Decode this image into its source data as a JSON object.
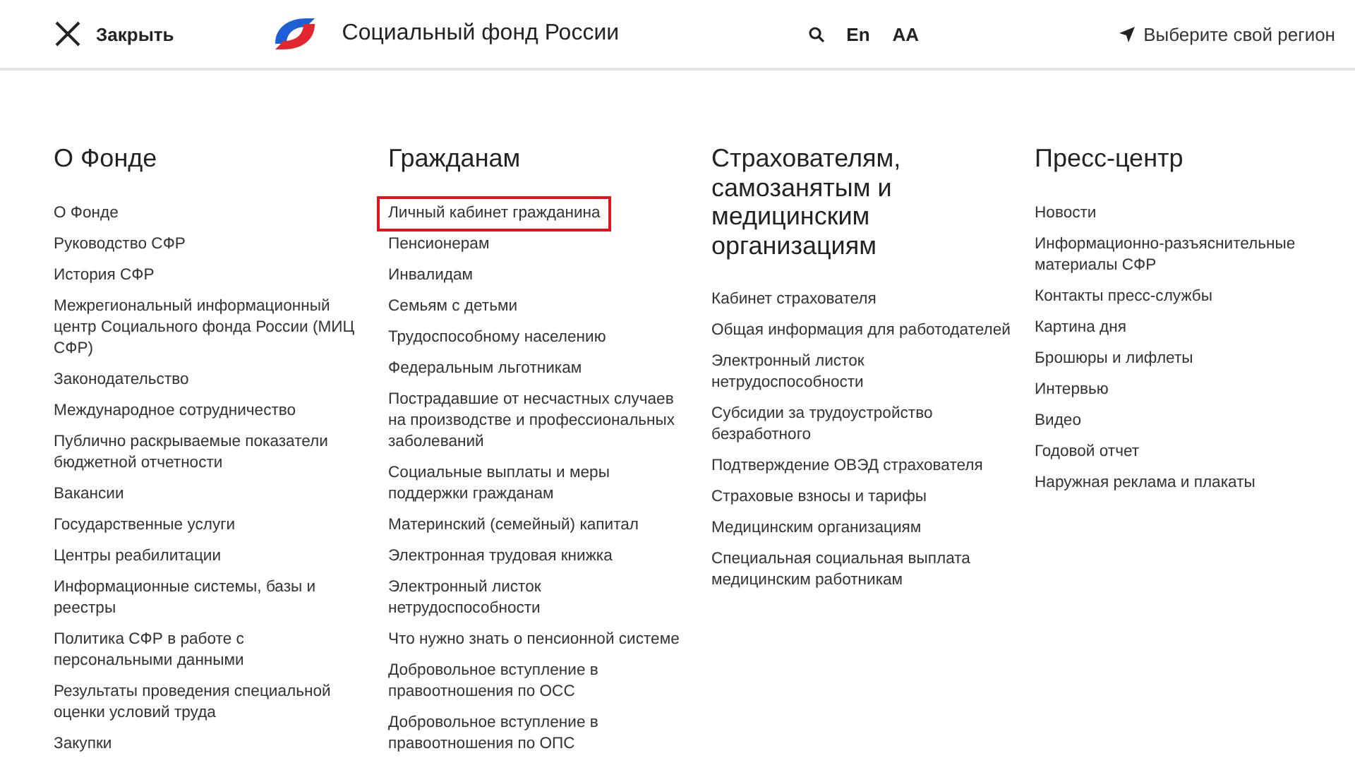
{
  "header": {
    "close_label": "Закрыть",
    "site_title": "Социальный фонд России",
    "language": "En",
    "font_size_toggle": "AA",
    "region": "Выберите свой регион"
  },
  "columns": [
    {
      "title": "О Фонде",
      "items": [
        {
          "label": "О Фонде",
          "highlighted": false
        },
        {
          "label": "Руководство СФР",
          "highlighted": false
        },
        {
          "label": "История СФР",
          "highlighted": false
        },
        {
          "label": "Межрегиональный информационный центр Социального фонда России (МИЦ СФР)",
          "highlighted": false
        },
        {
          "label": "Законодательство",
          "highlighted": false
        },
        {
          "label": "Международное сотрудничество",
          "highlighted": false
        },
        {
          "label": "Публично раскрываемые показатели бюджетной отчетности",
          "highlighted": false
        },
        {
          "label": "Вакансии",
          "highlighted": false
        },
        {
          "label": "Государственные услуги",
          "highlighted": false
        },
        {
          "label": "Центры реабилитации",
          "highlighted": false
        },
        {
          "label": "Информационные системы, базы и реестры",
          "highlighted": false
        },
        {
          "label": "Политика СФР в работе с персональными данными",
          "highlighted": false
        },
        {
          "label": "Результаты проведения специальной оценки условий труда",
          "highlighted": false
        },
        {
          "label": "Закупки",
          "highlighted": false
        }
      ]
    },
    {
      "title": "Гражданам",
      "items": [
        {
          "label": "Личный кабинет гражданина",
          "highlighted": true
        },
        {
          "label": "Пенсионерам",
          "highlighted": false
        },
        {
          "label": "Инвалидам",
          "highlighted": false
        },
        {
          "label": "Семьям с детьми",
          "highlighted": false
        },
        {
          "label": "Трудоспособному населению",
          "highlighted": false
        },
        {
          "label": "Федеральным льготникам",
          "highlighted": false
        },
        {
          "label": "Пострадавшие от несчастных случаев на производстве и профессиональных заболеваний",
          "highlighted": false
        },
        {
          "label": "Социальные выплаты и меры поддержки гражданам",
          "highlighted": false
        },
        {
          "label": "Материнский (семейный) капитал",
          "highlighted": false
        },
        {
          "label": "Электронная трудовая книжка",
          "highlighted": false
        },
        {
          "label": "Электронный листок нетрудоспособности",
          "highlighted": false
        },
        {
          "label": "Что нужно знать о пенсионной системе",
          "highlighted": false
        },
        {
          "label": "Добровольное вступление в правоотношения по ОСС",
          "highlighted": false
        },
        {
          "label": "Добровольное вступление в правоотношения по ОПС",
          "highlighted": false
        }
      ]
    },
    {
      "title": "Страхователям, самозанятым и медицинским организациям",
      "items": [
        {
          "label": "Кабинет страхователя",
          "highlighted": false
        },
        {
          "label": "Общая информация для работодателей",
          "highlighted": false
        },
        {
          "label": "Электронный листок нетрудоспособности",
          "highlighted": false
        },
        {
          "label": "Субсидии за трудоустройство безработного",
          "highlighted": false
        },
        {
          "label": "Подтверждение ОВЭД страхователя",
          "highlighted": false
        },
        {
          "label": "Страховые взносы и тарифы",
          "highlighted": false
        },
        {
          "label": "Медицинским организациям",
          "highlighted": false
        },
        {
          "label": "Специальная социальная выплата медицинским работникам",
          "highlighted": false
        }
      ]
    },
    {
      "title": "Пресс-центр",
      "items": [
        {
          "label": "Новости",
          "highlighted": false
        },
        {
          "label": "Информационно-разъяснительные материалы СФР",
          "highlighted": false
        },
        {
          "label": "Контакты пресс-службы",
          "highlighted": false
        },
        {
          "label": "Картина дня",
          "highlighted": false
        },
        {
          "label": "Брошюры и лифлеты",
          "highlighted": false
        },
        {
          "label": "Интервью",
          "highlighted": false
        },
        {
          "label": "Видео",
          "highlighted": false
        },
        {
          "label": "Годовой отчет",
          "highlighted": false
        },
        {
          "label": "Наружная реклама и плакаты",
          "highlighted": false
        }
      ]
    }
  ]
}
